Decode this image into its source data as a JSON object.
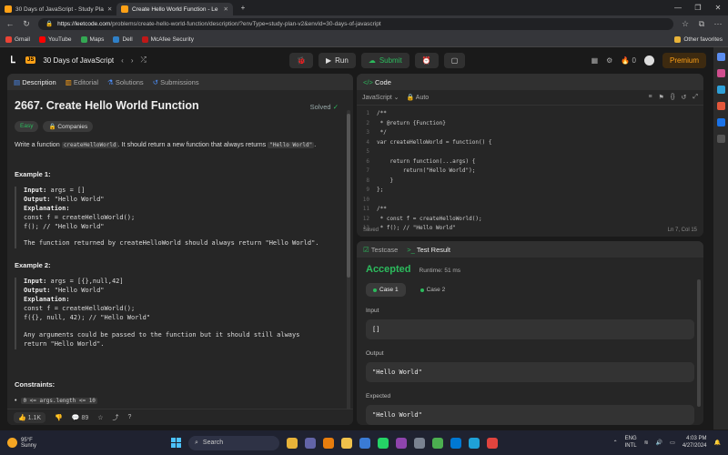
{
  "browser": {
    "tabs": [
      {
        "title": "30 Days of JavaScript - Study Pla"
      },
      {
        "title": "Create Hello World Function - Le"
      }
    ],
    "url_host": "https://leetcode.com",
    "url_path": "/problems/create-hello-world-function/description/?envType=study-plan-v2&envId=30-days-of-javascript",
    "bookmarks": [
      {
        "label": "Gmail",
        "color": "#ea4335"
      },
      {
        "label": "YouTube",
        "color": "#ff0000"
      },
      {
        "label": "Maps",
        "color": "#34a853"
      },
      {
        "label": "Dell",
        "color": "#2f80c8"
      },
      {
        "label": "McAfee Security",
        "color": "#c01818"
      }
    ],
    "other_favorites": "Other favorites"
  },
  "header": {
    "study_plan": "30 Days of JavaScript",
    "run": "Run",
    "submit": "Submit",
    "streak": "0",
    "premium": "Premium"
  },
  "left_tabs": [
    "Description",
    "Editorial",
    "Solutions",
    "Submissions"
  ],
  "problem": {
    "title": "2667. Create Hello World Function",
    "status": "Solved",
    "difficulty": "Easy",
    "companies": "Companies",
    "desc_a": "Write a function ",
    "desc_code1": "createHelloWorld",
    "desc_b": ". It should return a new function that always returns ",
    "desc_code2": "\"Hello World\"",
    "desc_c": ".",
    "example1": {
      "heading": "Example 1:",
      "input_label": "Input:",
      "input": " args = []",
      "output_label": "Output:",
      "output": " \"Hello World\"",
      "expl_label": "Explanation:",
      "line1": "const f = createHelloWorld();",
      "line2": "f(); // \"Hello World\"",
      "note": "The function returned by createHelloWorld should always return \"Hello World\"."
    },
    "example2": {
      "heading": "Example 2:",
      "input_label": "Input:",
      "input": " args = [{},null,42]",
      "output_label": "Output:",
      "output": " \"Hello World\"",
      "expl_label": "Explanation:",
      "line1": "const f = createHelloWorld();",
      "line2": "f({}, null, 42); // \"Hello World\"",
      "note1": "Any arguments could be passed to the function but it should still always",
      "note2": "return \"Hello World\"."
    },
    "constraints_heading": "Constraints:",
    "constraint1": "0 <= args.length <= 10",
    "likes": "1.1K",
    "comments": "89"
  },
  "code_panel": {
    "title": "Code",
    "language": "JavaScript",
    "mode": "Auto",
    "saved": "Saved",
    "cursor": "Ln 7, Col 15",
    "lines": [
      {
        "n": "1",
        "t": "/**"
      },
      {
        "n": "2",
        "t": " * @return {Function}"
      },
      {
        "n": "3",
        "t": " */"
      },
      {
        "n": "4",
        "t": "var createHelloWorld = function() {"
      },
      {
        "n": "5",
        "t": ""
      },
      {
        "n": "6",
        "t": "    return function(...args) {"
      },
      {
        "n": "7",
        "t": "        return(\"Hello World\");"
      },
      {
        "n": "8",
        "t": "    }"
      },
      {
        "n": "9",
        "t": "};"
      },
      {
        "n": "10",
        "t": ""
      },
      {
        "n": "11",
        "t": "/**"
      },
      {
        "n": "12",
        "t": " * const f = createHelloWorld();"
      },
      {
        "n": "13",
        "t": " * f(); // \"Hello World\""
      }
    ]
  },
  "result_panel": {
    "tab1": "Testcase",
    "tab2": "Test Result",
    "verdict": "Accepted",
    "runtime": "Runtime: 51 ms",
    "case1": "Case 1",
    "case2": "Case 2",
    "input_label": "Input",
    "input_value": "[]",
    "output_label": "Output",
    "output_value": "\"Hello World\"",
    "expected_label": "Expected",
    "expected_value": "\"Hello World\""
  },
  "taskbar": {
    "temp": "95°F",
    "weather": "Sunny",
    "search": "Search",
    "lang1": "ENG",
    "lang2": "INTL",
    "time": "4:03 PM",
    "date": "4/27/2024"
  }
}
